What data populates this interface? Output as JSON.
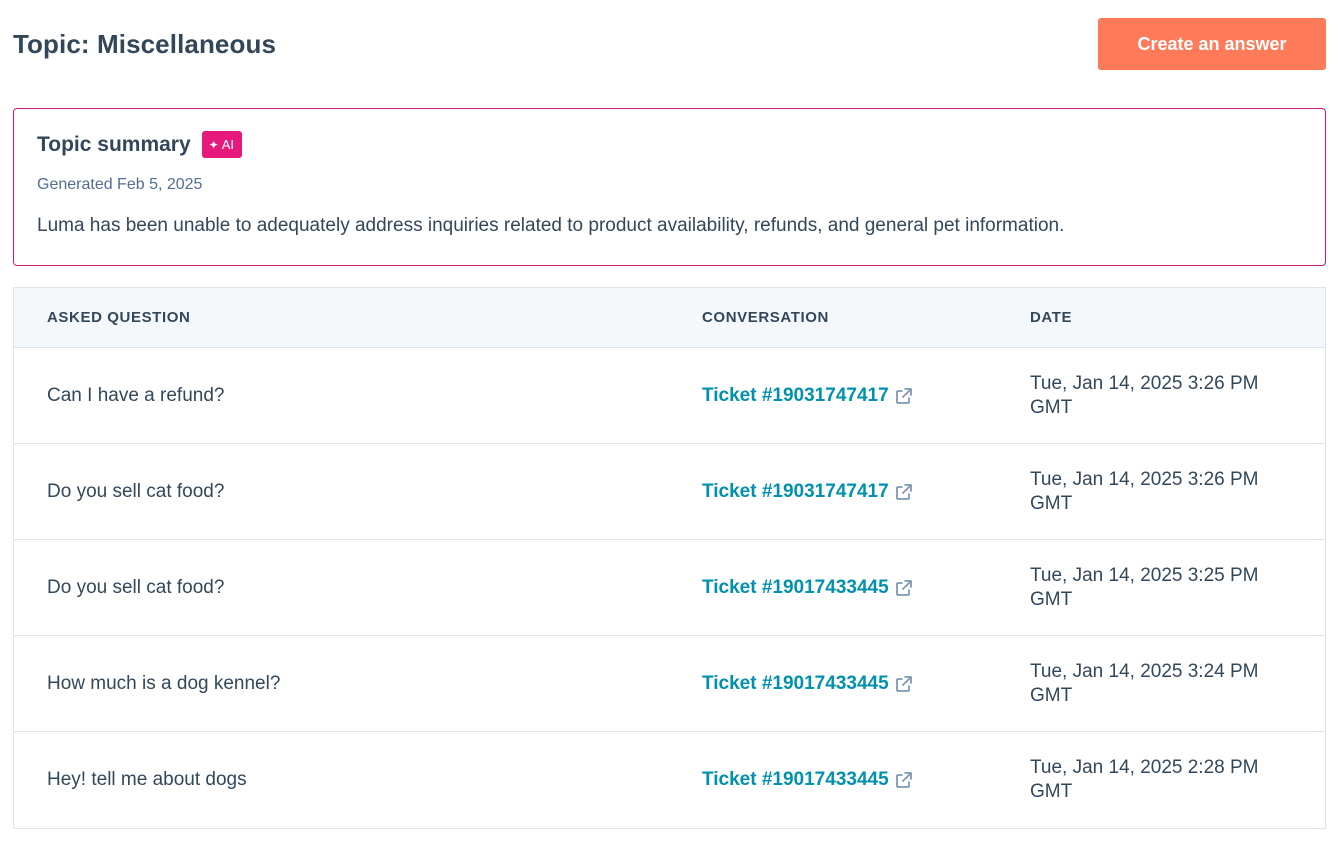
{
  "header": {
    "title": "Topic: Miscellaneous",
    "create_button_label": "Create an answer"
  },
  "summary": {
    "title": "Topic summary",
    "ai_badge": "AI",
    "generated": "Generated Feb 5, 2025",
    "text": "Luma has been unable to adequately address inquiries related to product availability, refunds, and general pet information."
  },
  "table": {
    "columns": [
      "ASKED QUESTION",
      "CONVERSATION",
      "DATE"
    ],
    "rows": [
      {
        "question": "Can I have a refund?",
        "ticket": "Ticket #19031747417",
        "date": "Tue, Jan 14, 2025 3:26 PM GMT"
      },
      {
        "question": "Do you sell cat food?",
        "ticket": "Ticket #19031747417",
        "date": "Tue, Jan 14, 2025 3:26 PM GMT"
      },
      {
        "question": "Do you sell cat food?",
        "ticket": "Ticket #19017433445",
        "date": "Tue, Jan 14, 2025 3:25 PM GMT"
      },
      {
        "question": "How much is a dog kennel?",
        "ticket": "Ticket #19017433445",
        "date": "Tue, Jan 14, 2025 3:24 PM GMT"
      },
      {
        "question": "Hey! tell me about dogs",
        "ticket": "Ticket #19017433445",
        "date": "Tue, Jan 14, 2025 2:28 PM GMT"
      }
    ]
  },
  "colors": {
    "primary_button": "#ff7a59",
    "ai_badge": "#e6197c",
    "summary_border": "#c81b7c",
    "link": "#0091ae",
    "text": "#33475b"
  },
  "icons": {
    "ai_badge_icon": "sparkle-icon",
    "ticket_link_icon": "external-link-icon"
  }
}
